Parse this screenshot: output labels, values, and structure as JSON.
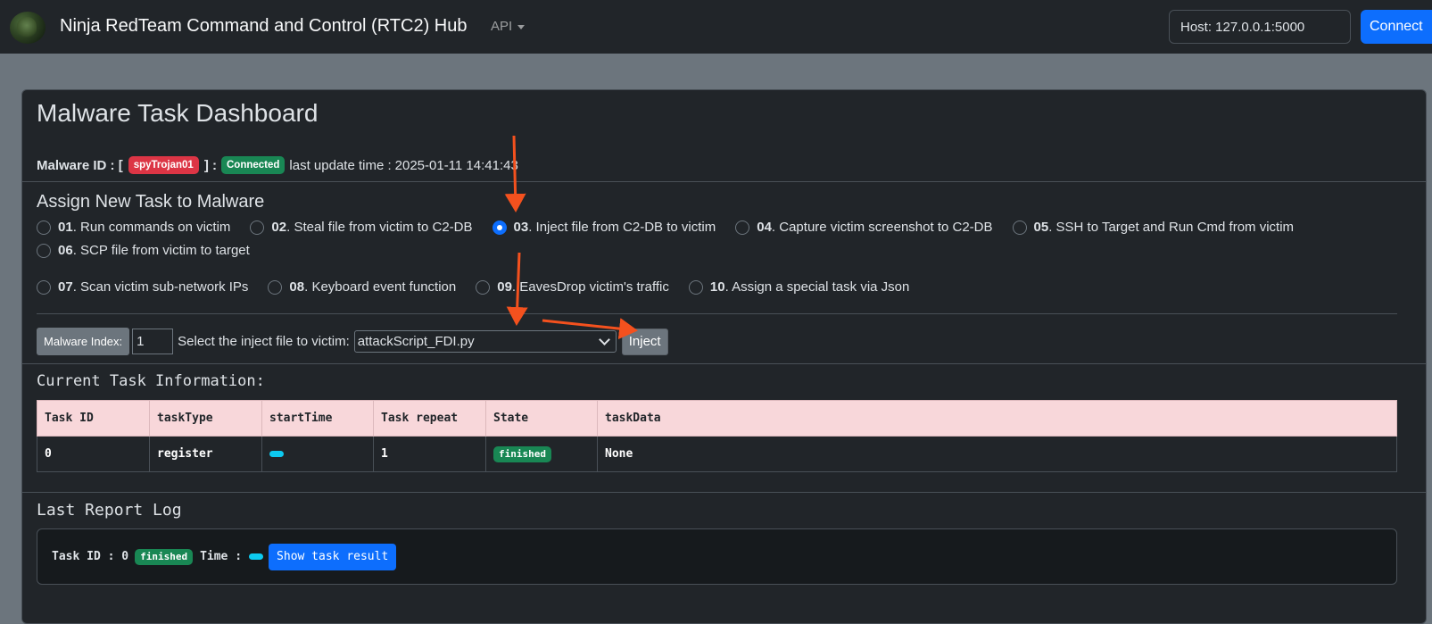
{
  "navbar": {
    "brand": "Ninja RedTeam Command and Control (RTC2) Hub",
    "api_menu": "API",
    "host_value": "Host: 127.0.0.1:5000",
    "connect_label": "Connect"
  },
  "dashboard": {
    "title": "Malware Task Dashboard",
    "malware_id_label": "Malware ID : [",
    "malware_id": "spyTrojan01",
    "malware_id_close": "] :",
    "connection_status": "Connected",
    "last_update_label": "last update time :",
    "last_update_time": "2025-01-11 14:41:43"
  },
  "assign": {
    "title": "Assign New Task to Malware",
    "tasks": [
      {
        "num": "01",
        "label": ". Run commands on victim",
        "checked": false
      },
      {
        "num": "02",
        "label": ". Steal file from victim to C2-DB",
        "checked": false
      },
      {
        "num": "03",
        "label": ". Inject file from C2-DB to victim",
        "checked": true
      },
      {
        "num": "04",
        "label": ". Capture victim screenshot to C2-DB",
        "checked": false
      },
      {
        "num": "05",
        "label": ". SSH to Target and Run Cmd from victim",
        "checked": false
      },
      {
        "num": "06",
        "label": ". SCP file from victim to target",
        "checked": false
      },
      {
        "num": "07",
        "label": ". Scan victim sub-network IPs",
        "checked": false
      },
      {
        "num": "08",
        "label": ". Keyboard event function",
        "checked": false
      },
      {
        "num": "09",
        "label": ". EavesDrop victim's traffic",
        "checked": false
      },
      {
        "num": "10",
        "label": ". Assign a special task via Json",
        "checked": false
      }
    ]
  },
  "inject": {
    "malware_index_label": "Malware Index:",
    "malware_index_value": "1",
    "select_label": "Select the inject file to victim:",
    "selected_file": "attackScript_FDI.py",
    "inject_button": "Inject"
  },
  "current_task": {
    "title": "Current Task Information:",
    "headers": [
      "Task ID",
      "taskType",
      "startTime",
      "Task repeat",
      "State",
      "taskData"
    ],
    "rows": [
      {
        "task_id": "0",
        "task_type": "register",
        "start_time": "",
        "repeat": "1",
        "state": "finished",
        "task_data": "None"
      }
    ]
  },
  "last_report": {
    "title": "Last Report Log",
    "task_id_label": "Task ID : 0",
    "state": "finished",
    "time_label": "Time :",
    "show_button": "Show task result"
  },
  "colors": {
    "navbar_bg": "#212529",
    "page_bg": "#6c757d",
    "primary": "#0d6efd",
    "danger": "#dc3545",
    "success": "#198754",
    "info": "#0dcaf0",
    "table_header_bg": "#f8d7da",
    "annotation_arrow": "#f4511e"
  }
}
